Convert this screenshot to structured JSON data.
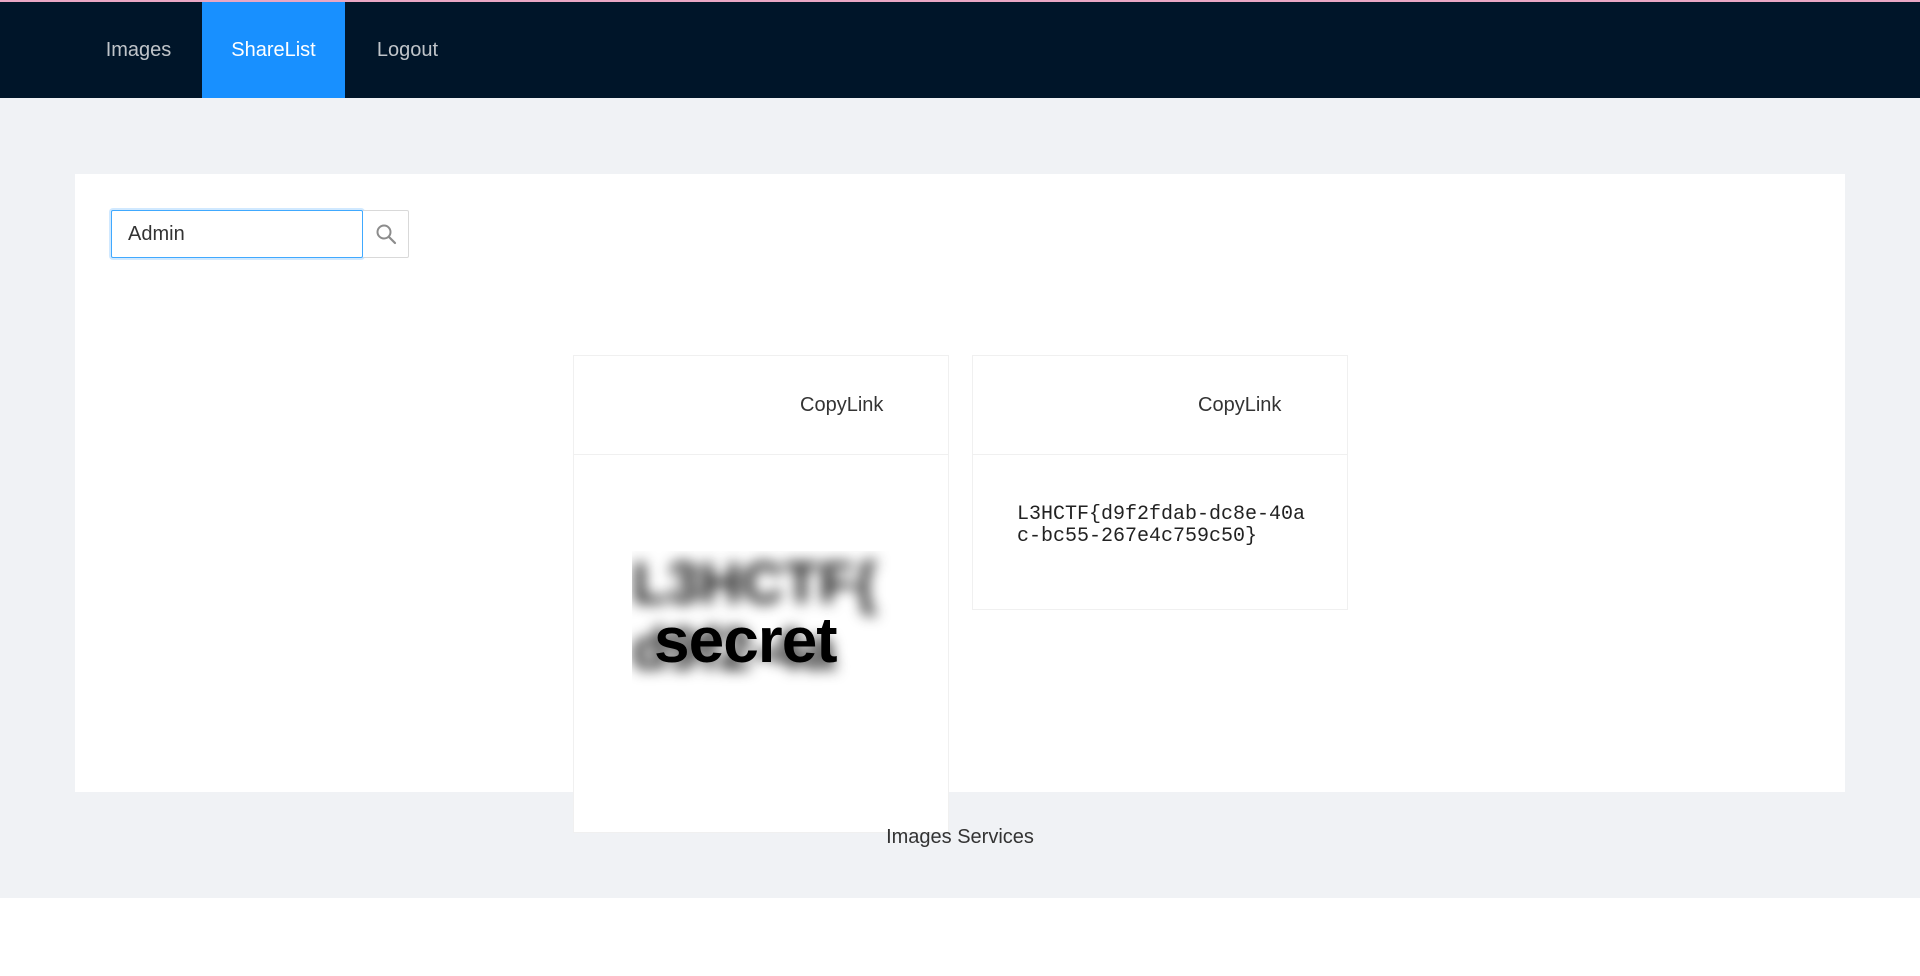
{
  "nav": {
    "items": [
      {
        "label": "Images",
        "active": false
      },
      {
        "label": "ShareList",
        "active": true
      },
      {
        "label": "Logout",
        "active": false
      }
    ],
    "accent_color": "#1890ff",
    "header_color": "#001529"
  },
  "search": {
    "value": "Admin",
    "button_icon": "search-icon"
  },
  "cards": [
    {
      "action_label": "CopyLink",
      "image_label": "secret",
      "image_blur_text": "L3HCTF{ d9f2-4a"
    },
    {
      "action_label": "CopyLink",
      "text": "L3HCTF{d9f2fdab-dc8e-40ac-bc55-267e4c759c50}"
    }
  ],
  "footer": {
    "text": "Images Services"
  }
}
